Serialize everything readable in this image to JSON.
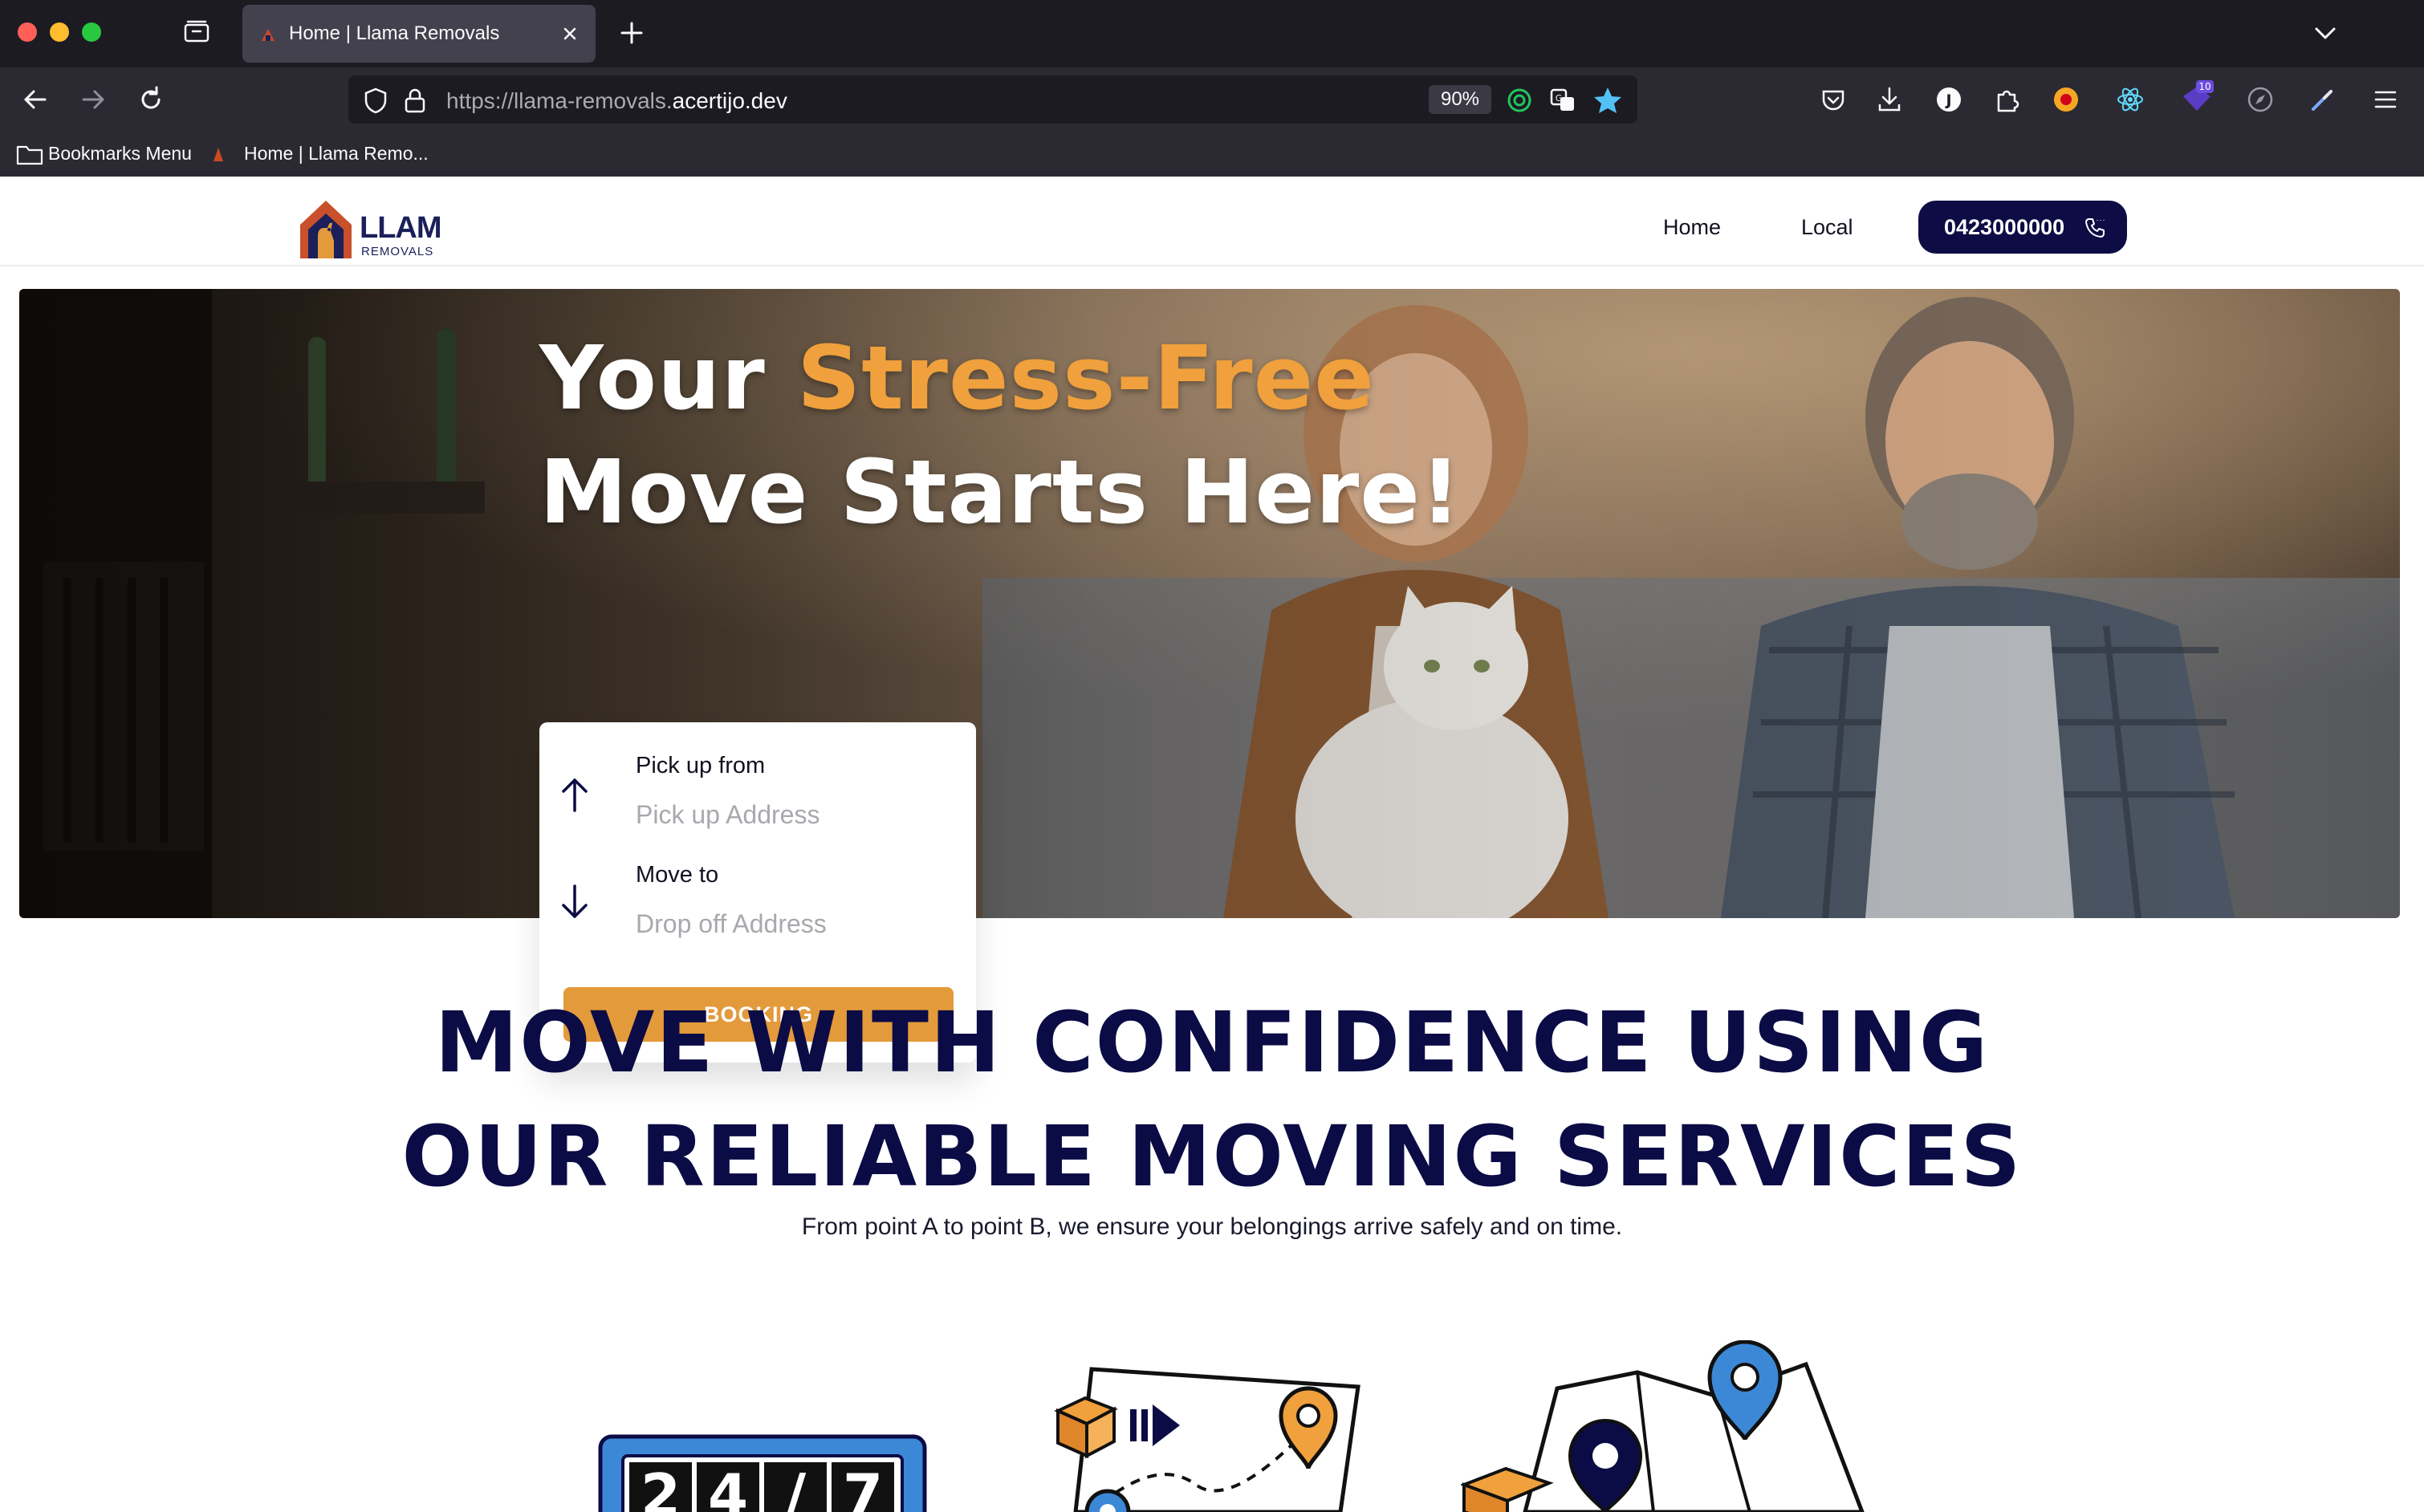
{
  "browser": {
    "tab_title": "Home | Llama Removals",
    "url_prefix": "https://llama-removals.",
    "url_host": "acertijo.dev",
    "zoom": "90%",
    "extension_badge": "10",
    "bookmarks": {
      "menu_label": "Bookmarks Menu",
      "item_label": "Home | Llama Remo..."
    }
  },
  "site": {
    "logo_text": "LLAMA",
    "logo_subtext": "REMOVALS",
    "nav": {
      "home": "Home",
      "local": "Local"
    },
    "phone": "0423000000"
  },
  "hero": {
    "title_start": "Your ",
    "title_accent": "Stress-Free",
    "title_line2": "Move Starts Here!",
    "accent_color": "#f0a03c"
  },
  "booking": {
    "pickup_label": "Pick up from",
    "pickup_placeholder": "Pick up Address",
    "dropoff_label": "Move to",
    "dropoff_placeholder": "Drop off Address",
    "button_label": "BOOKING"
  },
  "services": {
    "title_line1": "MOVE WITH CONFIDENCE USING",
    "title_line2": "OUR RELIABLE MOVING SERVICES",
    "subtitle": "From point A to point B, we ensure your belongings arrive safely and on time.",
    "illustration_247_digits": [
      "2",
      "4",
      "/",
      "7"
    ]
  },
  "colors": {
    "navy": "#0b0b45",
    "orange": "#e39a3b",
    "chrome_dark": "#1c1b22"
  }
}
